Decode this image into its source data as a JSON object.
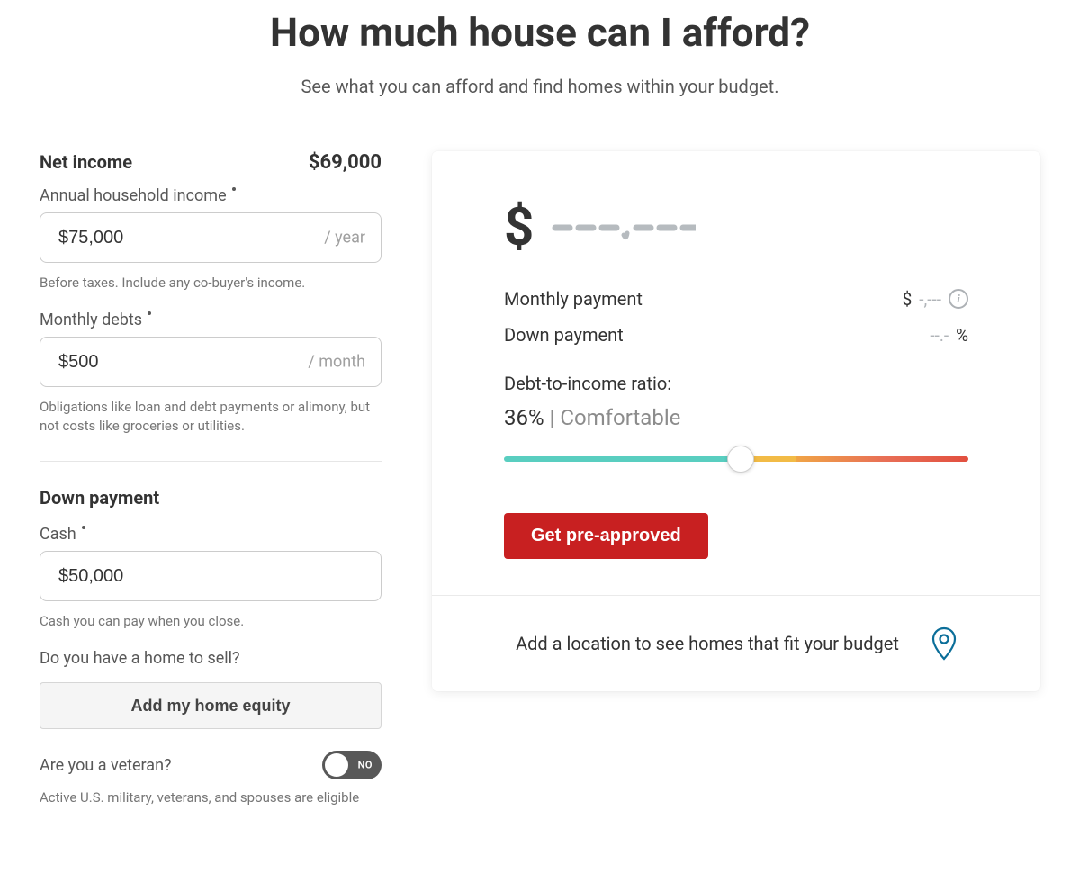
{
  "header": {
    "title": "How much house can I afford?",
    "subtitle": "See what you can afford and find homes within your budget."
  },
  "form": {
    "net_income": {
      "heading": "Net income",
      "value_display": "$69,000"
    },
    "annual_income": {
      "label": "Annual household income",
      "value": "$75,000",
      "suffix": "/ year",
      "help": "Before taxes. Include any co-buyer's income."
    },
    "monthly_debts": {
      "label": "Monthly debts",
      "value": "$500",
      "suffix": "/ month",
      "help": "Obligations like loan and debt payments or alimony, but not costs like groceries or utilities."
    },
    "down_payment": {
      "heading": "Down payment",
      "cash_label": "Cash",
      "cash_value": "$50,000",
      "cash_help": "Cash you can pay when you close."
    },
    "home_to_sell": {
      "question": "Do you have a home to sell?",
      "button": "Add my home equity"
    },
    "veteran": {
      "question": "Are you a veteran?",
      "toggle_state": "NO",
      "help": "Active U.S. military, veterans, and spouses are eligible"
    }
  },
  "results": {
    "price_currency": "$",
    "price_placeholder": "---,---",
    "monthly_payment": {
      "label": "Monthly payment",
      "currency": "$",
      "value": "-,---"
    },
    "down_payment_pct": {
      "label": "Down payment",
      "value": "--.-",
      "unit": "%"
    },
    "dti": {
      "label": "Debt-to-income ratio:",
      "percent": "36%",
      "separator": " | ",
      "status": "Comfortable",
      "slider_position_pct": 51
    },
    "cta": "Get pre-approved",
    "footer_text": "Add a location to see homes that fit your budget"
  }
}
